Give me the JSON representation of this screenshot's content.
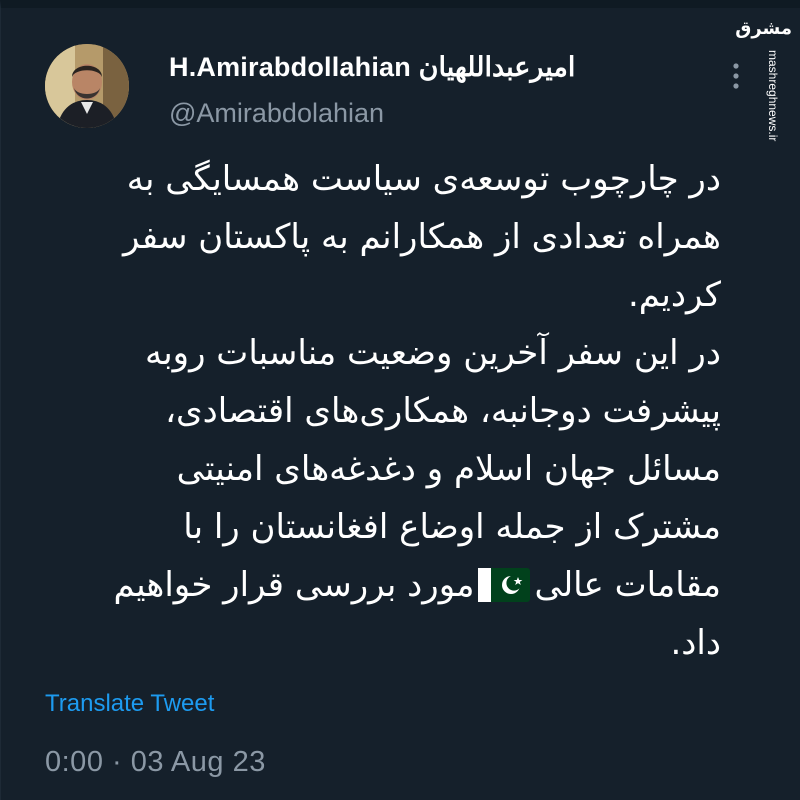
{
  "watermark": {
    "logo_text": "مشرق",
    "site": "mashreghnews.ir"
  },
  "tweet": {
    "display_name": "H.Amirabdollahian امیرعبداللهیان",
    "handle": "@Amirabdolahian",
    "text_lines": [
      "در چارچوب توسعه‌ی سیاست همسایگی به",
      "همراه تعدادی از همکارانم به پاکستان سفر",
      "کردیم.",
      "در این سفر آخرین وضعیت مناسبات روبه",
      "پیشرفت دوجانبه، همکاری‌های اقتصادی،",
      "مسائل جهان اسلام و دغدغه‌های امنیتی",
      "مشترک از جمله اوضاع افغانستان را با",
      "مورد بررسی قرار خواهیم",
      "مقامات عالی",
      "داد."
    ],
    "flag_icon": "pakistan-flag-icon",
    "translate_label": "Translate Tweet",
    "timestamp": "0:00 · 03 Aug 23"
  },
  "colors": {
    "background": "#15202b",
    "text": "#ffffff",
    "secondary": "#8b98a5",
    "link": "#1d9bf0"
  },
  "icons": {
    "more": "more-vertical-icon"
  }
}
